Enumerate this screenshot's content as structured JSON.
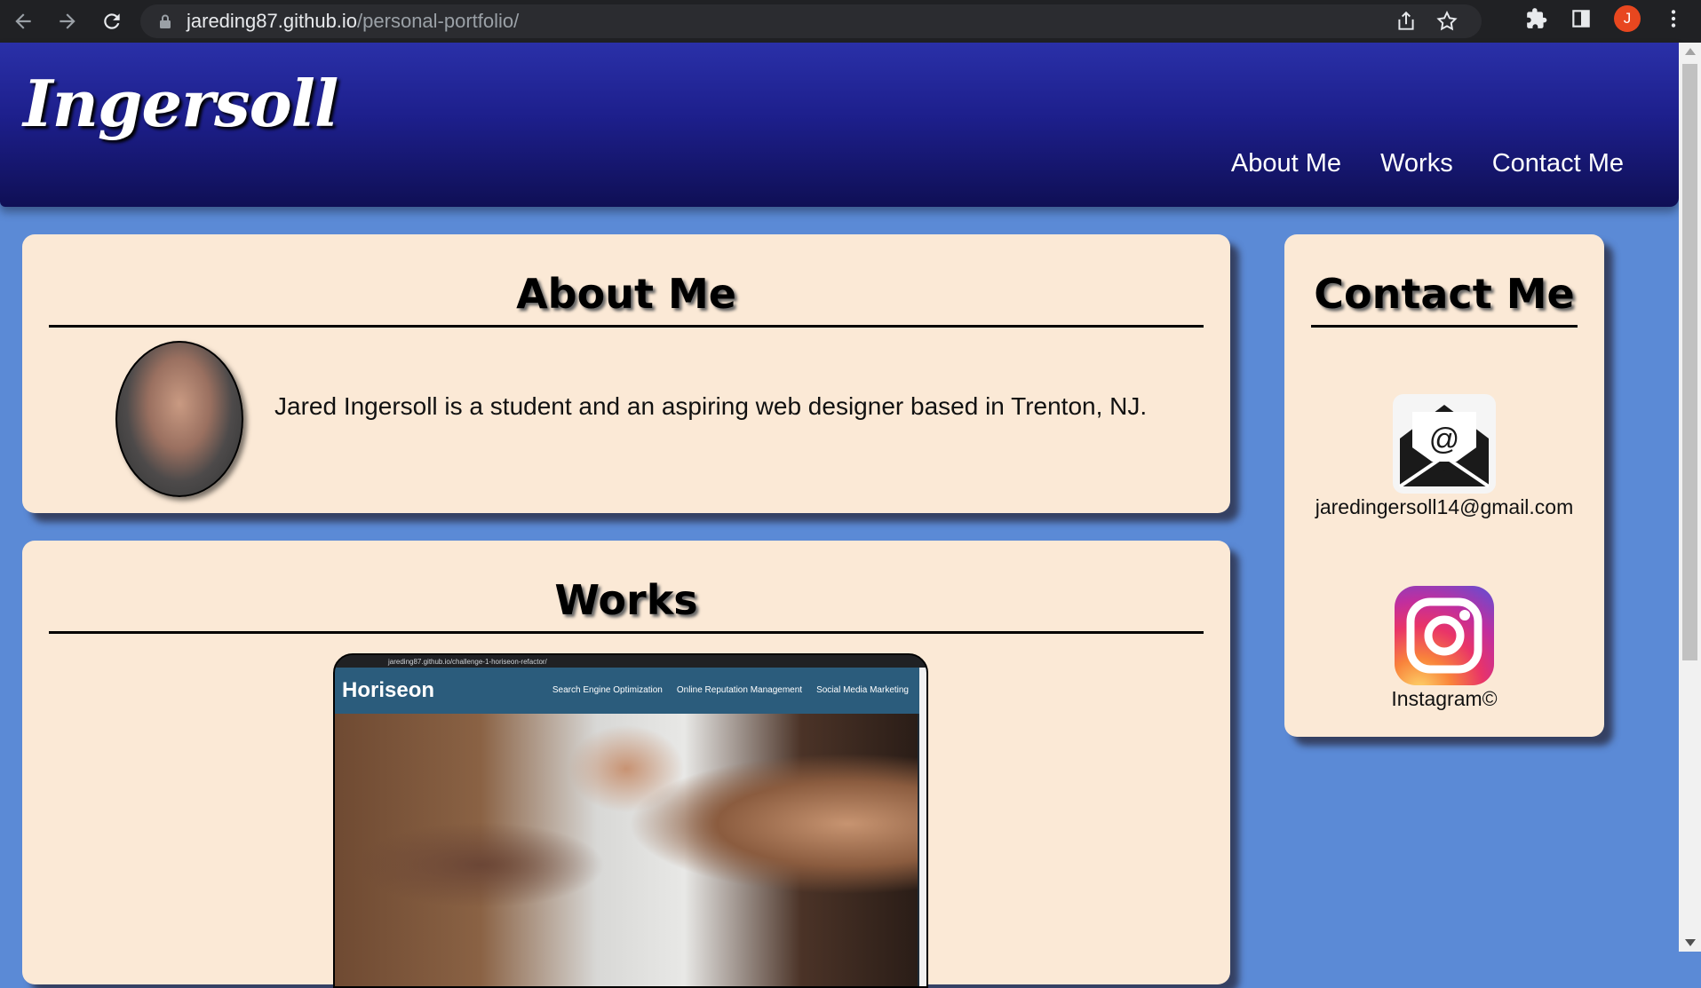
{
  "browser": {
    "url_host": "jareding87.github.io",
    "url_path": "/personal-portfolio/",
    "profile_initial": "J",
    "profile_color": "#e8471f"
  },
  "header": {
    "logo": "Ingersoll",
    "nav": [
      {
        "label": "About Me"
      },
      {
        "label": "Works"
      },
      {
        "label": "Contact Me"
      }
    ]
  },
  "about": {
    "title": "About Me",
    "text": "Jared Ingersoll is a student and an aspiring web designer based in Trenton, NJ."
  },
  "works": {
    "title": "Works",
    "preview": {
      "url": "jareding87.github.io/challenge-1-horiseon-refactor/",
      "logo": "Horiseon",
      "nav": [
        "Search Engine Optimization",
        "Online Reputation Management",
        "Social Media Marketing"
      ]
    }
  },
  "contact": {
    "title": "Contact Me",
    "email": "jaredingersoll14@gmail.com",
    "instagram": "Instagram©"
  },
  "colors": {
    "page_bg": "#5b8ad6",
    "card_bg": "#fbe9d6",
    "header_top": "#2a30a8",
    "header_bottom": "#0f0f55"
  },
  "icons": [
    "back-icon",
    "forward-icon",
    "reload-icon",
    "lock-icon",
    "share-icon",
    "star-icon",
    "extensions-icon",
    "side-panel-icon",
    "menu-icon",
    "mail-icon",
    "instagram-icon"
  ]
}
